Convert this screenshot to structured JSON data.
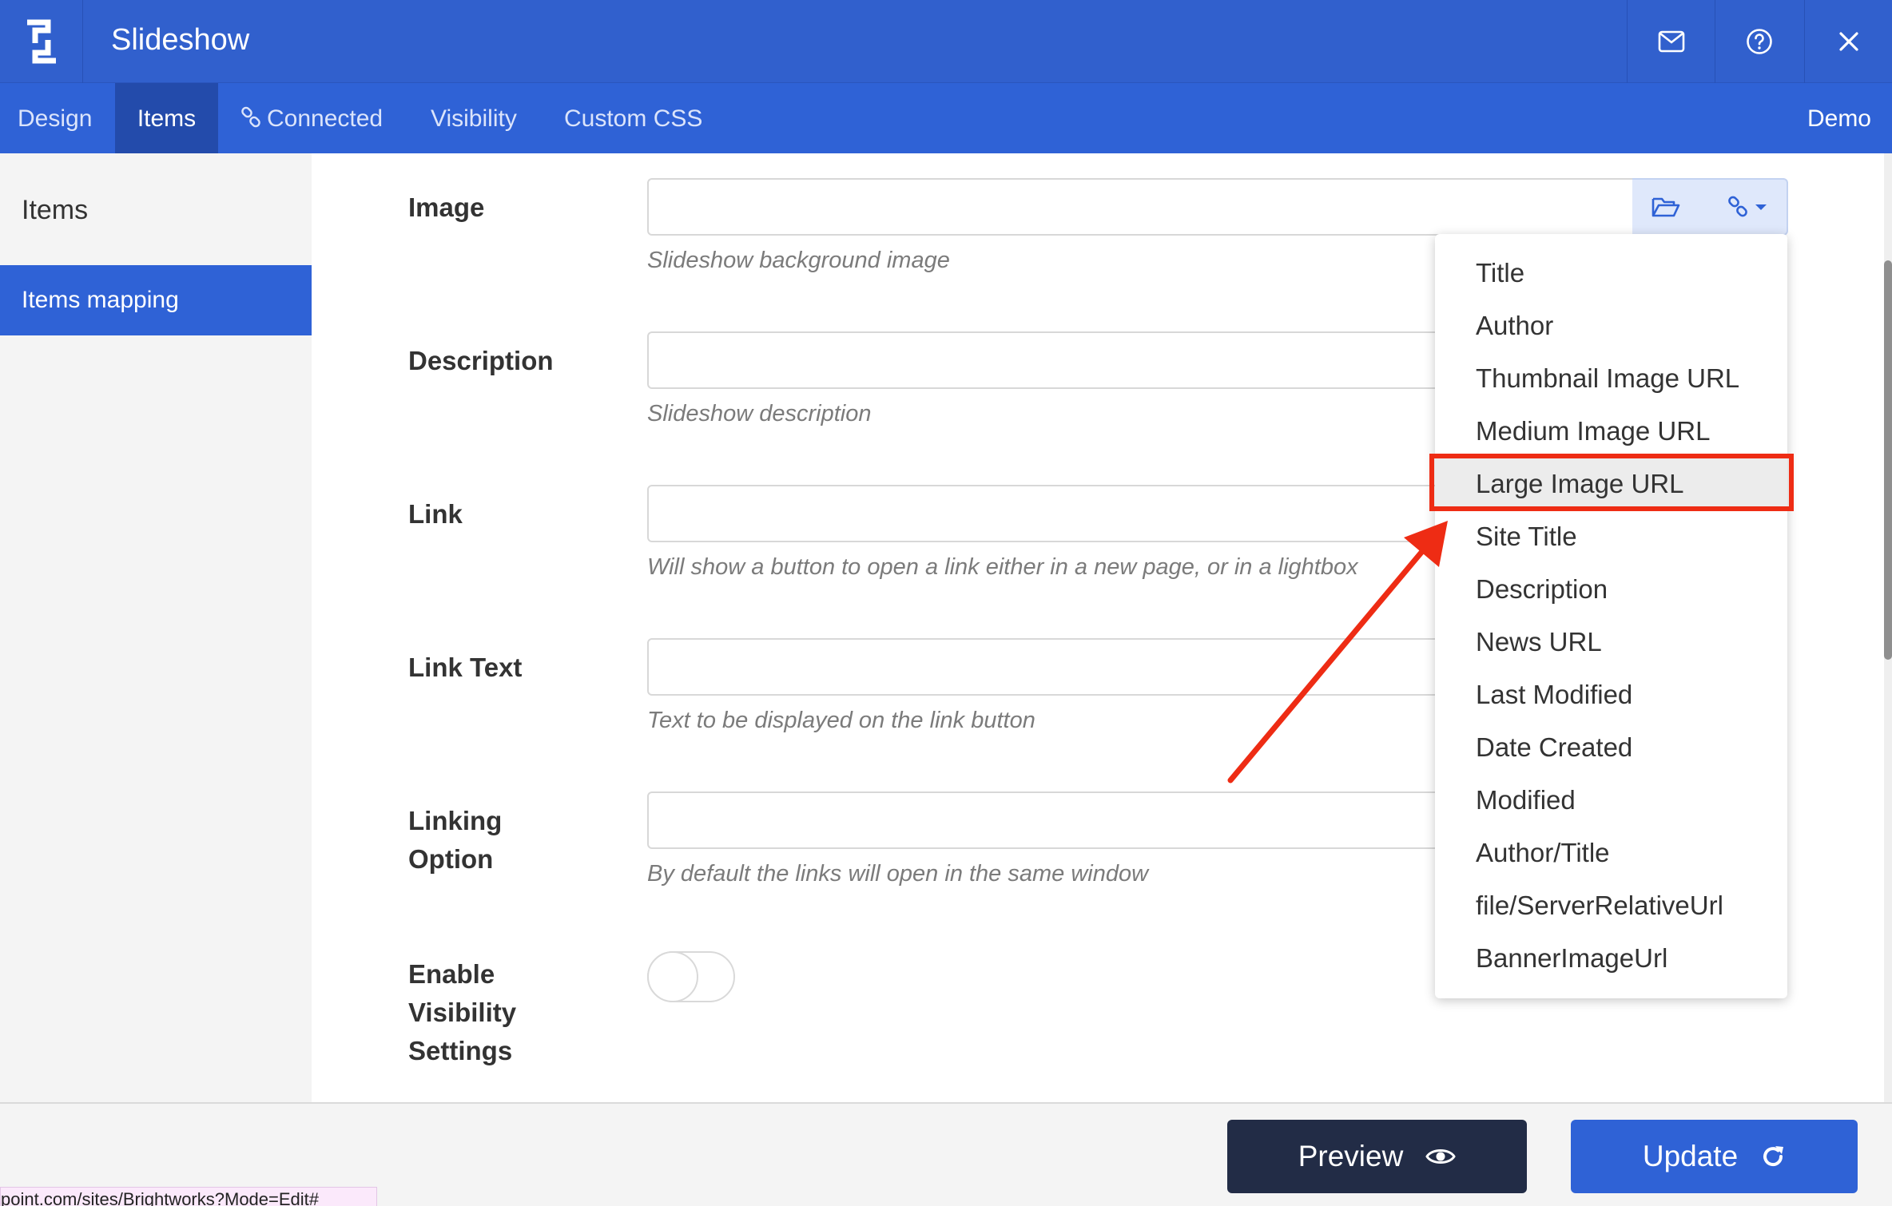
{
  "header": {
    "title": "Slideshow",
    "icons": {
      "logo": "app-logo-icon",
      "mail": "mail-icon",
      "help": "help-circle-icon",
      "close": "close-icon"
    }
  },
  "tabs": {
    "design": "Design",
    "items": "Items",
    "connected": "Connected",
    "visibility": "Visibility",
    "custom_css": "Custom CSS",
    "demo": "Demo"
  },
  "sidebar": {
    "heading": "Items",
    "active_item": "Items mapping"
  },
  "form": {
    "image": {
      "label": "Image",
      "value": "",
      "help": "Slideshow background image"
    },
    "description": {
      "label": "Description",
      "value": "",
      "help": "Slideshow description"
    },
    "link": {
      "label": "Link",
      "value": "",
      "help": "Will show a button to open a link either in a new page, or in a lightbox"
    },
    "link_text": {
      "label": "Link Text",
      "value": "",
      "help": "Text to be displayed on the link button"
    },
    "linking_option": {
      "label_line1": "Linking",
      "label_line2": "Option",
      "value": "",
      "help": "By default the links will open in the same window"
    },
    "visibility": {
      "label_line1": "Enable",
      "label_line2": "Visibility",
      "label_line3": "Settings",
      "enabled": false
    }
  },
  "dropdown": {
    "items": [
      "Title",
      "Author",
      "Thumbnail Image URL",
      "Medium Image URL",
      "Large Image URL",
      "Site Title",
      "Description",
      "News URL",
      "Last Modified",
      "Date Created",
      "Modified",
      "Author/Title",
      "file/ServerRelativeUrl",
      "BannerImageUrl"
    ],
    "highlighted": "Large Image URL"
  },
  "footer": {
    "preview_label": "Preview",
    "update_label": "Update"
  },
  "status_bar": {
    "url": "point.com/sites/Brightworks?Mode=Edit#"
  },
  "colors": {
    "header_blue": "#3160cd",
    "tab_blue": "#2f62d6",
    "active_tab": "#234bab",
    "preview_dark": "#222c46",
    "annotation_red": "#ee2c14"
  }
}
